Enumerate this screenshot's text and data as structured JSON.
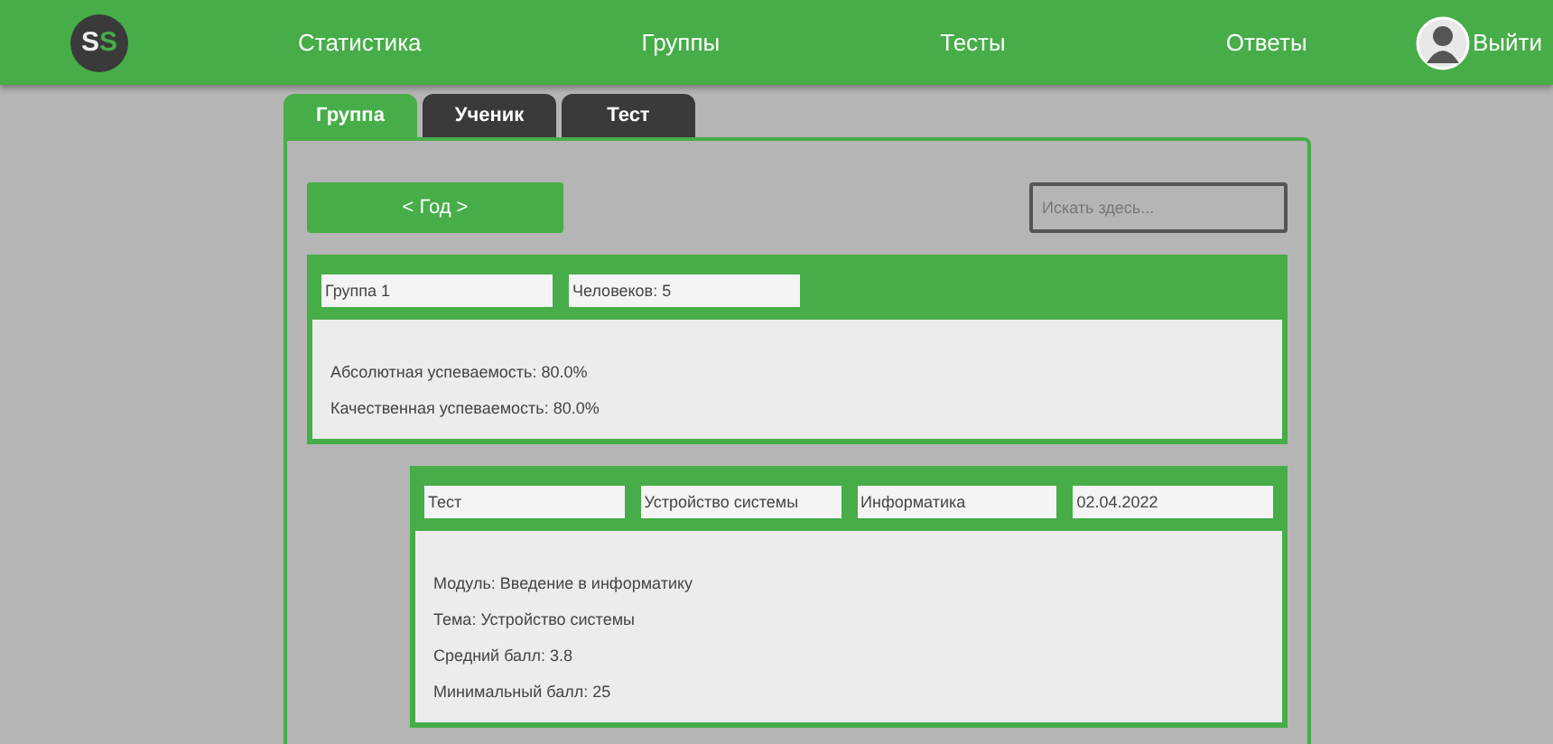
{
  "logo": {
    "text": "SS"
  },
  "nav": [
    {
      "label": "Статистика"
    },
    {
      "label": "Группы"
    },
    {
      "label": "Тесты"
    },
    {
      "label": "Ответы"
    }
  ],
  "user": {
    "logout": "Выйти"
  },
  "tabs": [
    {
      "label": "Группа",
      "selected": true
    },
    {
      "label": "Ученик",
      "selected": false
    },
    {
      "label": "Тест",
      "selected": false
    }
  ],
  "year_button": "< Год >",
  "search": {
    "placeholder": "Искать здесь..."
  },
  "group_card": {
    "fields": [
      "Группа 1",
      "Человеков: 5"
    ],
    "lines": [
      "Абсолютная успеваемость: 80.0%",
      "Качественная успеваемость: 80.0%"
    ]
  },
  "test_card": {
    "fields": [
      "Тест",
      "Устройство системы",
      "Информатика",
      "02.04.2022"
    ],
    "lines": [
      "Модуль: Введение в информатику",
      "Тема: Устройство системы",
      "Средний балл: 3.8",
      "Минимальный балл: 25"
    ]
  }
}
